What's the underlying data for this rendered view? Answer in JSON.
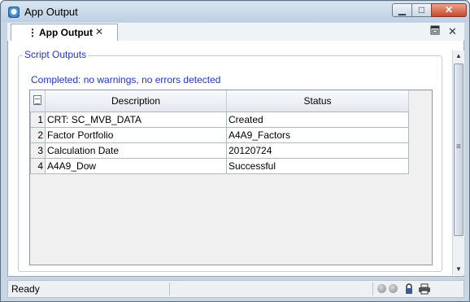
{
  "window": {
    "title": "App Output"
  },
  "tabstrip": {
    "tab_grip": "⋮",
    "tab_label": "App Output",
    "tab_close": "✕",
    "restore_glyph": "🗖",
    "close_glyph": "✕"
  },
  "panel": {
    "group_title": "Script Outputs",
    "status_message": "Completed: no warnings, no errors detected"
  },
  "table": {
    "columns": [
      "Description",
      "Status"
    ],
    "rows": [
      {
        "num": "1",
        "description": "CRT: SC_MVB_DATA",
        "status": "Created"
      },
      {
        "num": "2",
        "description": "Factor Portfolio",
        "status": "A4A9_Factors"
      },
      {
        "num": "3",
        "description": "Calculation Date",
        "status": "20120724"
      },
      {
        "num": "4",
        "description": "A4A9_Dow",
        "status": "Successful"
      }
    ]
  },
  "statusbar": {
    "text": "Ready"
  },
  "colors": {
    "link_blue": "#2233cc",
    "title_bg": "#c8d6e4",
    "close_red": "#c74a2c"
  }
}
